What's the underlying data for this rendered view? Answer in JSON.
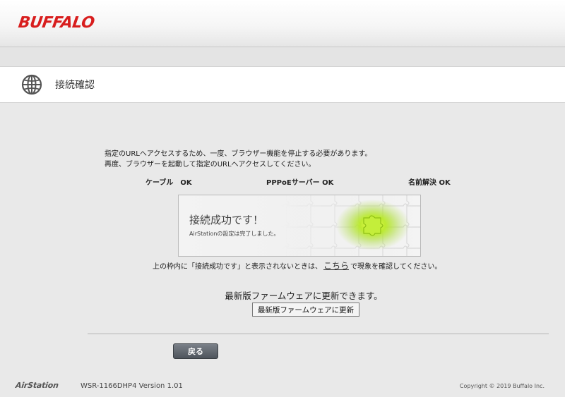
{
  "brand": {
    "logo_text": "BUFFALO",
    "accent": "#d81e1e"
  },
  "page": {
    "title": "接続確認",
    "icon": "globe-icon"
  },
  "messages": {
    "line1": "指定のURLへアクセスするため、一度、ブラウザー機能を停止する必要があります。",
    "line2": "再度、ブラウザーを起動して指定のURLへアクセスしてください。"
  },
  "status": {
    "cable": "ケーブル　OK",
    "pppoe": "PPPoEサーバー OK",
    "dns": "名前解決 OK"
  },
  "success_frame": {
    "title": "接続成功です！",
    "subtitle": "AirStationの設定は完了しました。",
    "highlight_color": "#a6e01a"
  },
  "hint": {
    "before": "上の枠内に「接続成功です」と表示されないときは、",
    "link": "こちら",
    "after": "で現象を確認してください。"
  },
  "firmware": {
    "message": "最新版ファームウェアに更新できます。",
    "button_label": "最新版ファームウェアに更新"
  },
  "back_button_label": "戻る",
  "footer": {
    "product_logo": "AirStation",
    "model": "WSR-1166DHP4 Version 1.01",
    "copyright": "Copyright © 2019 Buffalo Inc."
  }
}
